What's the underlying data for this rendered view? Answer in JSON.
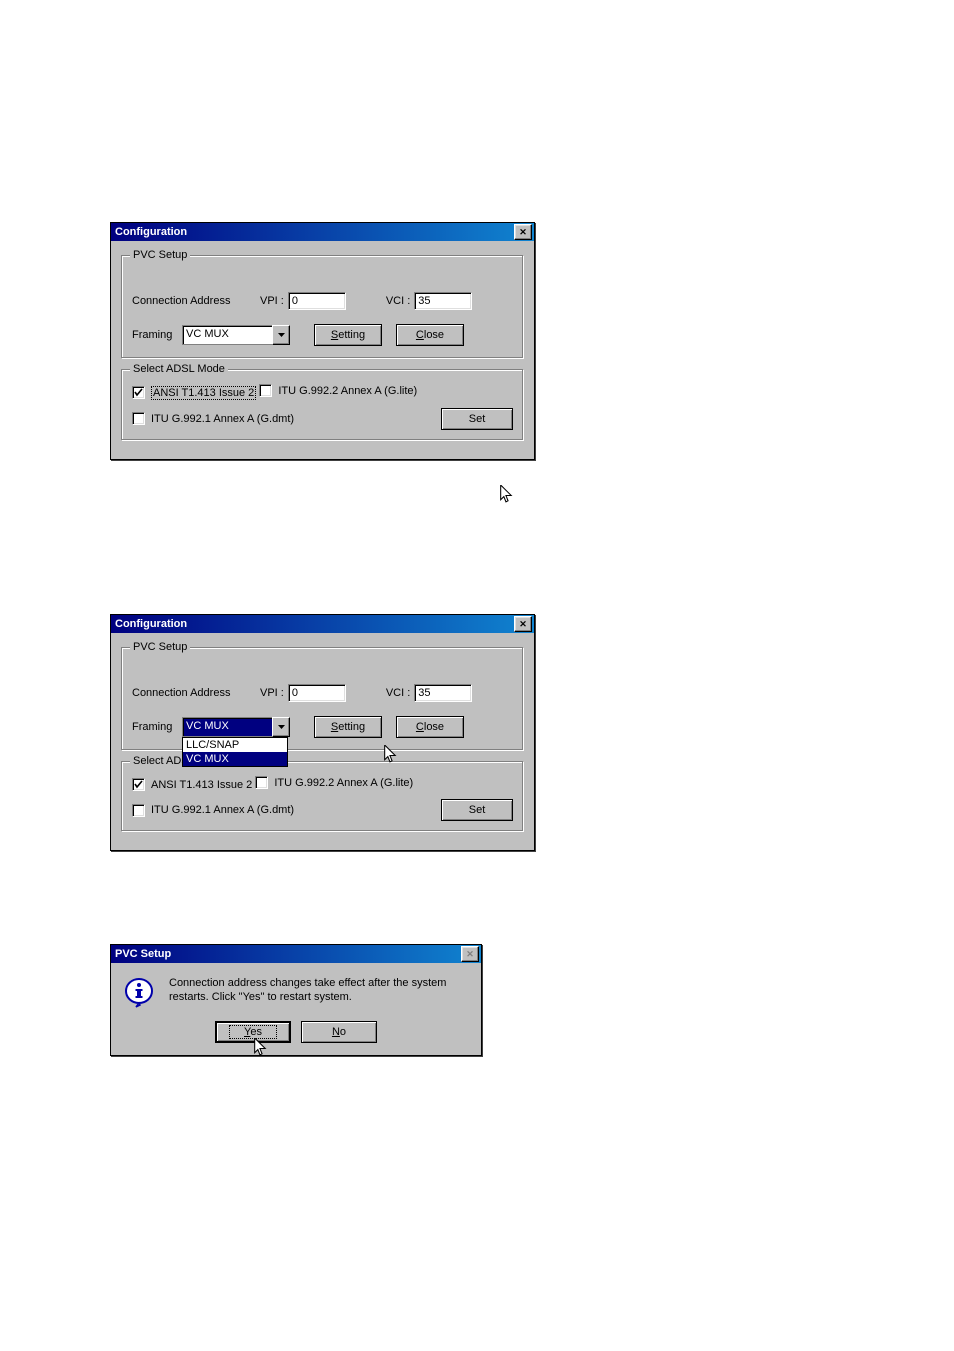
{
  "dialog1": {
    "title": "Configuration",
    "pvc": {
      "legend": "PVC Setup",
      "conn_label": "Connection Address",
      "vpi_label": "VPI :",
      "vpi_value": "0",
      "vci_label": "VCI :",
      "vci_value": "35",
      "framing_label": "Framing",
      "framing_value": "VC MUX",
      "setting_label_pre": "S",
      "setting_label_u": "",
      "setting_label": "Setting",
      "close_label": "Close"
    },
    "adsl": {
      "legend": "Select ADSL Mode",
      "opts": [
        "ANSI T1.413 Issue 2",
        "ITU G.992.2 Annex A (G.lite)",
        "ITU G.992.1 Annex A (G.dmt)"
      ],
      "set_label": "Set"
    }
  },
  "dialog2": {
    "title": "Configuration",
    "pvc": {
      "legend": "PVC Setup",
      "conn_label": "Connection Address",
      "vpi_label": "VPI :",
      "vpi_value": "0",
      "vci_label": "VCI :",
      "vci_value": "35",
      "framing_label": "Framing",
      "framing_value": "VC MUX",
      "options": [
        "LLC/SNAP",
        "VC MUX"
      ],
      "setting_label": "Setting",
      "close_label": "Close"
    },
    "adsl": {
      "legend": "Select ADSL Mode",
      "opts": [
        "ANSI T1.413 Issue 2",
        "ITU G.992.2 Annex A (G.lite)",
        "ITU G.992.1 Annex A (G.dmt)"
      ],
      "set_label": "Set"
    }
  },
  "msgbox": {
    "title": "PVC Setup",
    "text": "Connection address changes take effect after the system restarts. Click \"Yes\" to restart system.",
    "yes": "Yes",
    "no": "No"
  }
}
